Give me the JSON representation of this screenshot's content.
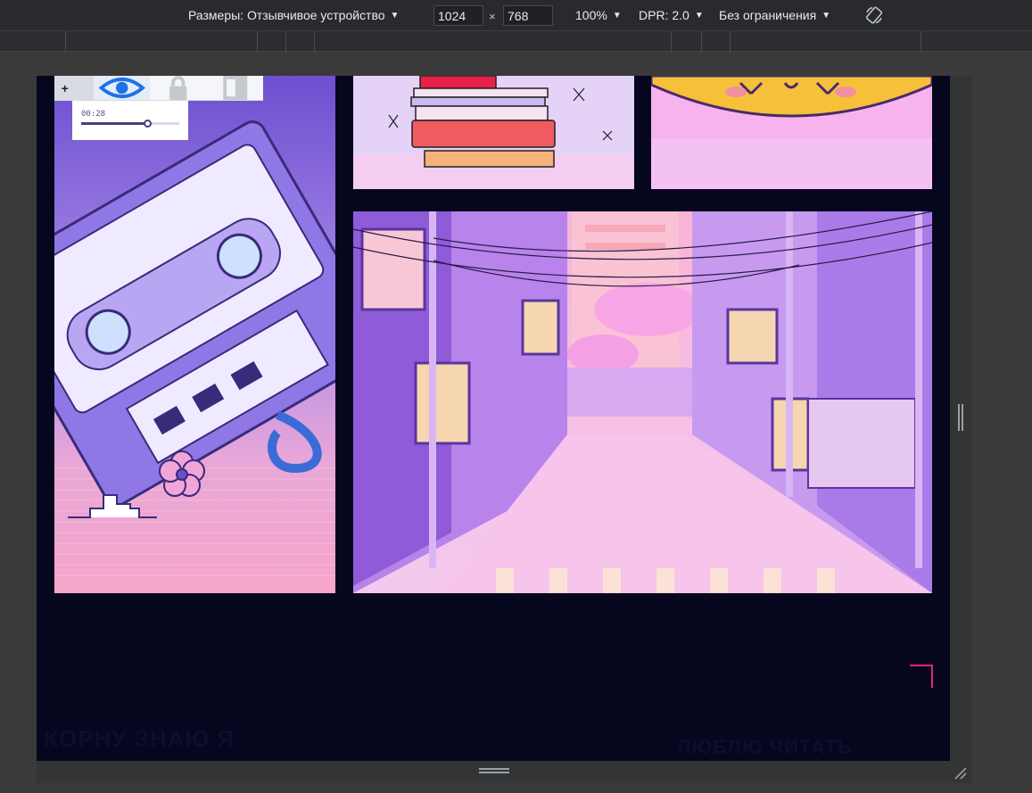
{
  "toolbar": {
    "dimensions_label": "Размеры: Отзывчивое устройство",
    "width_value": "1024",
    "height_value": "768",
    "times": "×",
    "zoom_label": "100%",
    "dpr_label": "DPR: 2.0",
    "throttle_label": "Без ограничения"
  },
  "player": {
    "add_label": "+",
    "time": "00:28",
    "progress": 0.67
  },
  "page": {
    "footer_left_text": "КОРНУ ЗНАЮ Я",
    "footer_right_text": "ЛЮБЛЮ ЧИТАТЬ"
  },
  "colors": {
    "page_bg": "#06061f",
    "accent": "#e0286a",
    "toolbar_bg": "#292a2d"
  }
}
